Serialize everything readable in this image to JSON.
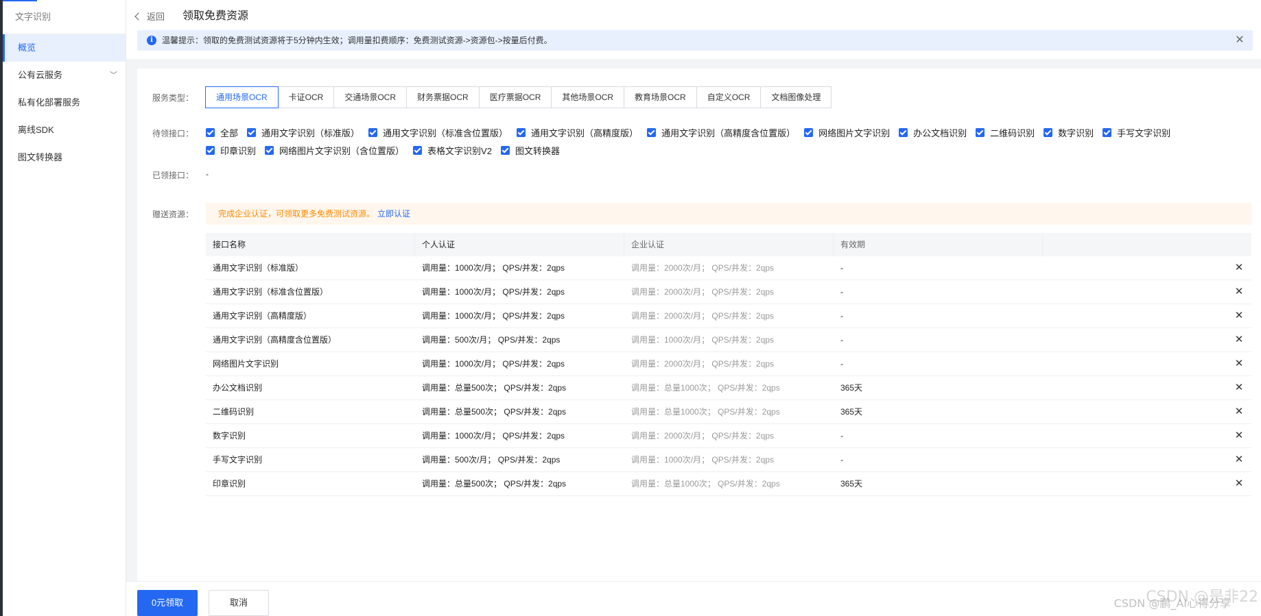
{
  "sidebar": {
    "title": "文字识别",
    "items": [
      {
        "label": "概览",
        "active": true
      },
      {
        "label": "公有云服务",
        "has_children": true
      },
      {
        "label": "私有化部署服务"
      },
      {
        "label": "离线SDK"
      },
      {
        "label": "图文转换器"
      }
    ]
  },
  "header": {
    "back_label": "返回",
    "title": "领取免费资源"
  },
  "notice": {
    "text": "温馨提示：领取的免费测试资源将于5分钟内生效；调用量扣费顺序：免费测试资源->资源包->按量后付费。"
  },
  "form": {
    "service_type_label": "服务类型：",
    "service_tabs": [
      "通用场景OCR",
      "卡证OCR",
      "交通场景OCR",
      "财务票据OCR",
      "医疗票据OCR",
      "其他场景OCR",
      "教育场景OCR",
      "自定义OCR",
      "文档图像处理"
    ],
    "active_tab": "通用场景OCR",
    "pending_label": "待领接口：",
    "pending_row1": [
      "全部",
      "通用文字识别（标准版）",
      "通用文字识别（标准含位置版）",
      "通用文字识别（高精度版）",
      "通用文字识别（高精度含位置版）",
      "网络图片文字识别",
      "办公文档识别",
      "二维码识别",
      "数字识别",
      "手写文字识别"
    ],
    "pending_row2": [
      "印章识别",
      "网络图片文字识别（含位置版）",
      "表格文字识别V2",
      "图文转换器"
    ],
    "claimed_label": "已领接口：",
    "claimed_value": "-",
    "gift_label": "赠送资源：",
    "promo_text": "完成企业认证，可领取更多免费测试资源。",
    "promo_link": "立即认证"
  },
  "table": {
    "headers": [
      "接口名称",
      "个人认证",
      "企业认证",
      "有效期"
    ],
    "rows": [
      {
        "name": "通用文字识别（标准版）",
        "personal": "调用量：1000次/月； QPS/并发：2qps",
        "enterprise": "调用量：2000次/月； QPS/并发：2qps",
        "validity": "-"
      },
      {
        "name": "通用文字识别（标准含位置版）",
        "personal": "调用量：1000次/月； QPS/并发：2qps",
        "enterprise": "调用量：2000次/月； QPS/并发：2qps",
        "validity": "-"
      },
      {
        "name": "通用文字识别（高精度版）",
        "personal": "调用量：1000次/月； QPS/并发：2qps",
        "enterprise": "调用量：2000次/月； QPS/并发：2qps",
        "validity": "-"
      },
      {
        "name": "通用文字识别（高精度含位置版）",
        "personal": "调用量：500次/月； QPS/并发：2qps",
        "enterprise": "调用量：1000次/月； QPS/并发：2qps",
        "validity": "-"
      },
      {
        "name": "网络图片文字识别",
        "personal": "调用量：1000次/月； QPS/并发：2qps",
        "enterprise": "调用量：2000次/月； QPS/并发：2qps",
        "validity": "-"
      },
      {
        "name": "办公文档识别",
        "personal": "调用量：总量500次； QPS/并发：2qps",
        "enterprise": "调用量：总量1000次； QPS/并发：2qps",
        "validity": "365天"
      },
      {
        "name": "二维码识别",
        "personal": "调用量：总量500次； QPS/并发：2qps",
        "enterprise": "调用量：总量1000次； QPS/并发：2qps",
        "validity": "365天"
      },
      {
        "name": "数字识别",
        "personal": "调用量：1000次/月； QPS/并发：2qps",
        "enterprise": "调用量：2000次/月； QPS/并发：2qps",
        "validity": "-"
      },
      {
        "name": "手写文字识别",
        "personal": "调用量：500次/月； QPS/并发：2qps",
        "enterprise": "调用量：1000次/月； QPS/并发：2qps",
        "validity": "-"
      },
      {
        "name": "印章识别",
        "personal": "调用量：总量500次； QPS/并发：2qps",
        "enterprise": "调用量：总量1000次； QPS/并发：2qps",
        "validity": "365天"
      }
    ]
  },
  "footer": {
    "claim_button": "0元领取",
    "cancel_button": "取消"
  },
  "watermark": {
    "line1": "CSDN @是非22",
    "line2": "CSDN @鹏_AI心得分享"
  },
  "colors": {
    "accent": "#2468f2",
    "promo_text": "#ff8a00",
    "promo_bg": "#fff7ed",
    "notice_bg": "#e8f0fe"
  },
  "icons": {
    "back": "chevron-left-icon",
    "info": "info-icon",
    "close": "close-icon",
    "expand": "chevron-down-icon",
    "checkbox": "checkbox-checked-icon"
  }
}
